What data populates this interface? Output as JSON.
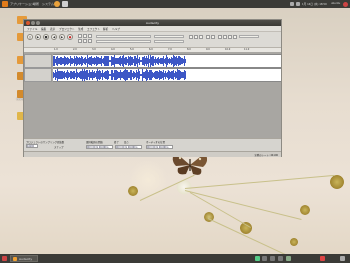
{
  "top_panel": {
    "menus": [
      "アプリケーション",
      "場所",
      "システム"
    ],
    "clock": "1月 14日 (水) 18:59",
    "user": "ubuntu"
  },
  "desktop_icons": [
    {
      "label": "",
      "name": "folder-icon"
    },
    {
      "label": "",
      "name": "folder-icon"
    },
    {
      "label": "",
      "name": "folder-icon"
    },
    {
      "label": "",
      "name": "folder-icon"
    },
    {
      "label": "Examples",
      "name": "folder-icon"
    },
    {
      "label": "",
      "name": "document-icon"
    }
  ],
  "window": {
    "title": "Audacity",
    "menus": [
      "ファイル",
      "編集",
      "表示",
      "プロジェクト",
      "生成",
      "エフェクト",
      "解析",
      "ヘルプ"
    ],
    "ruler_ticks": [
      "1.0",
      "2.0",
      "3.0",
      "4.0",
      "5.0",
      "6.0",
      "7.0",
      "8.0",
      "9.0",
      "10.0",
      "11.0"
    ],
    "selection": {
      "rate_label": "プロジェクトのサンプリング周波数",
      "rate_value": "44100",
      "snap_label": "スナップ",
      "start_label": "選択範囲の開始",
      "end_label": "終了",
      "length_label": "長さ",
      "audio_pos_label": "オーディオの位置",
      "start_value": "00 h 00 m 00.000 s",
      "end_value": "00 h 00 m 00.000 s",
      "pos_value": "00 h 00 m 00.000 s"
    },
    "status": "実際のレート: 44100"
  },
  "taskbar": {
    "app_label": "Audacity"
  },
  "colors": {
    "wave": "#3d57c6",
    "panel": "#3b3b37"
  }
}
